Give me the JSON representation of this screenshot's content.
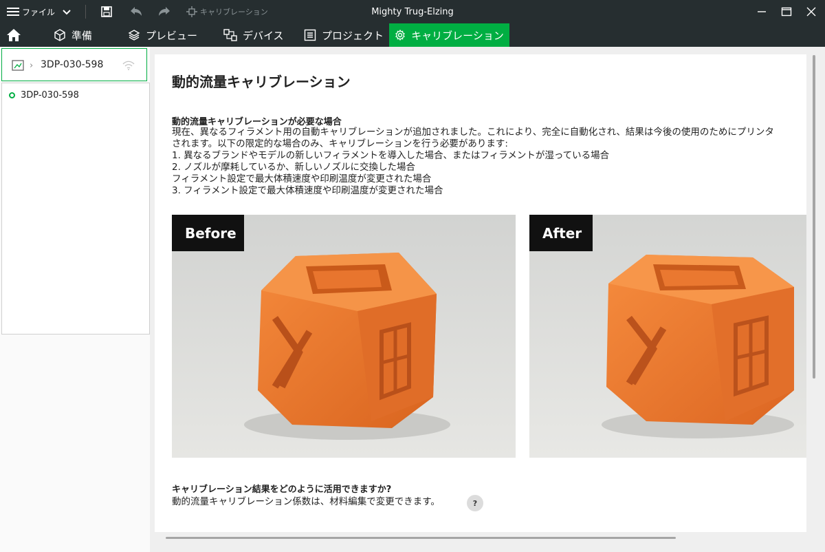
{
  "titlebar": {
    "menu_label": "ファイル",
    "calibration_label": "キャリブレーション",
    "app_title": "Mighty Trug-Elzing"
  },
  "nav": {
    "tabs": [
      {
        "label": "準備",
        "icon": "cube-icon"
      },
      {
        "label": "プレビュー",
        "icon": "layers-icon"
      },
      {
        "label": "デバイス",
        "icon": "device-icon"
      },
      {
        "label": "プロジェクト",
        "icon": "project-icon"
      },
      {
        "label": "キャリブレーション",
        "icon": "gear-icon",
        "active": true
      }
    ]
  },
  "device": {
    "selected": "3DP-030-598",
    "list": [
      {
        "name": "3DP-030-598"
      }
    ]
  },
  "content": {
    "title": "動的流量キャリブレーション",
    "section1_title": "動的流量キャリブレーションが必要な場合",
    "section1_lines": [
      "現在、異なるフィラメント用の自動キャリブレーションが追加されました。これにより、完全に自動化され、結果は今後の使用のためにプリンタ",
      "されます。以下の限定的な場合のみ、キャリブレーションを行う必要があります:",
      "1. 異なるブランドやモデルの新しいフィラメントを導入した場合、またはフィラメントが湿っている場合",
      "2. ノズルが摩耗しているか、新しいノズルに交換した場合",
      "フィラメント設定で最大体積速度や印刷温度が変更された場合",
      "3. フィラメント設定で最大体積速度や印刷温度が変更された場合"
    ],
    "before_label": "Before",
    "after_label": "After",
    "section2_title": "キャリブレーション結果をどのように活用できますか?",
    "section2_line": "動的流量キャリブレーション係数は、材料編集で変更できます。",
    "help_label": "?"
  },
  "colors": {
    "accent": "#00ae42",
    "titlebar_bg": "#262e30",
    "filament": "#ef7a2f"
  }
}
